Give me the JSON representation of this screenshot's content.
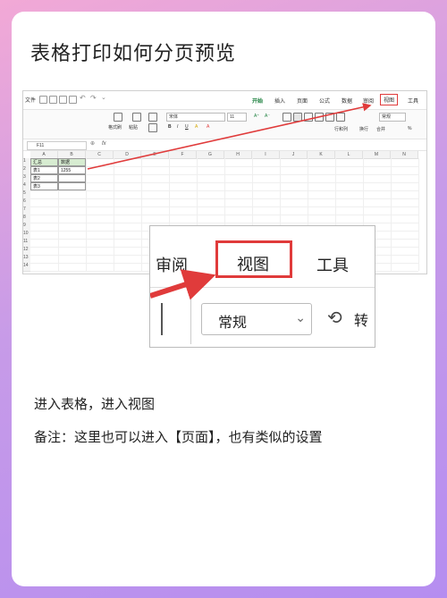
{
  "title": "表格打印如何分页预览",
  "screenshot": {
    "file_menu": "文件",
    "tabs": [
      "开始",
      "插入",
      "页面",
      "公式",
      "数据",
      "审阅",
      "视图",
      "工具"
    ],
    "active_tab": "开始",
    "highlighted_tab": "视图",
    "ribbon": {
      "format_painter": "格式刷",
      "paste": "粘贴",
      "font_name": "宋体",
      "font_size": "11",
      "format_select": "常规",
      "rows_cols": "行和列",
      "wrap": "换行",
      "merge": "合并",
      "percent": "%"
    },
    "formula_bar": {
      "cell_ref": "F11",
      "fx": "fx"
    },
    "columns": [
      "A",
      "B",
      "C",
      "D",
      "E",
      "F",
      "G",
      "H",
      "I",
      "J",
      "K",
      "L",
      "M",
      "N"
    ],
    "rows": [
      "1",
      "2",
      "3",
      "4",
      "5",
      "6",
      "7",
      "8",
      "9",
      "10",
      "11",
      "12",
      "13",
      "14"
    ],
    "table": {
      "headers": [
        "汇总",
        "数据"
      ],
      "rows": [
        [
          "表1",
          "1255"
        ],
        [
          "表2",
          ""
        ],
        [
          "表3",
          ""
        ]
      ]
    }
  },
  "zoom": {
    "tab_review": "审阅",
    "tab_view": "视图",
    "tab_tools": "工具",
    "format_value": "常规",
    "convert_label": "转"
  },
  "paragraphs": {
    "line1": "进入表格，进入视图",
    "line2": "备注：这里也可以进入【页面】，也有类似的设置"
  },
  "colors": {
    "accent_red": "#e03b3b",
    "active_green": "#1a7f3c",
    "header_fill": "#d7ecd1"
  }
}
